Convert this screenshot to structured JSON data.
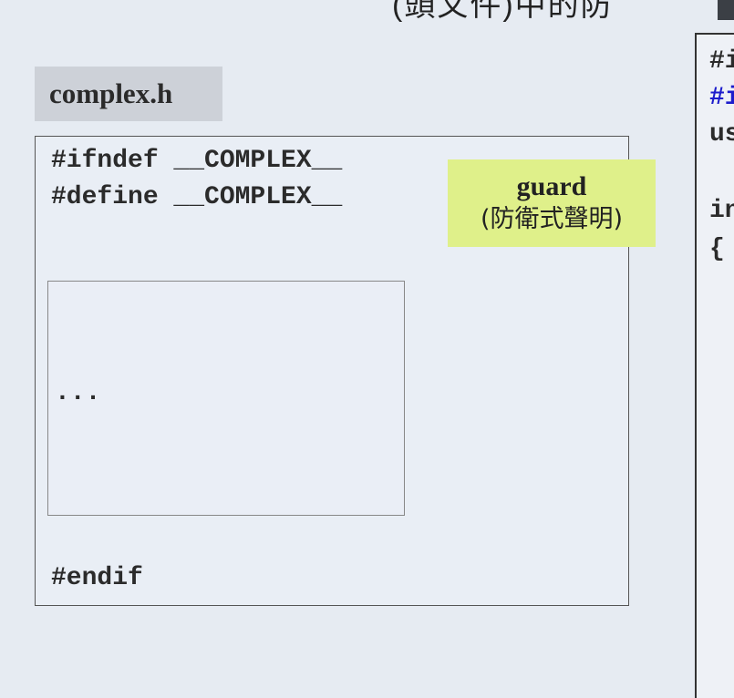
{
  "slide_title_partial": "(頭文件)中的防",
  "file_tab": "complex.h",
  "code": {
    "line1": "#ifndef __COMPLEX__",
    "line2": "#define __COMPLEX__",
    "ellipsis": "...",
    "endif": "#endif"
  },
  "guard_label": {
    "title": "guard",
    "subtitle": "(防衛式聲明)"
  },
  "right_panel_lines": [
    "#i",
    "#i",
    "us",
    "in",
    "{"
  ],
  "colors": {
    "background": "#e6ebf2",
    "guard_highlight": "#dff08a",
    "right_panel_blue": "#1c1ccc"
  }
}
